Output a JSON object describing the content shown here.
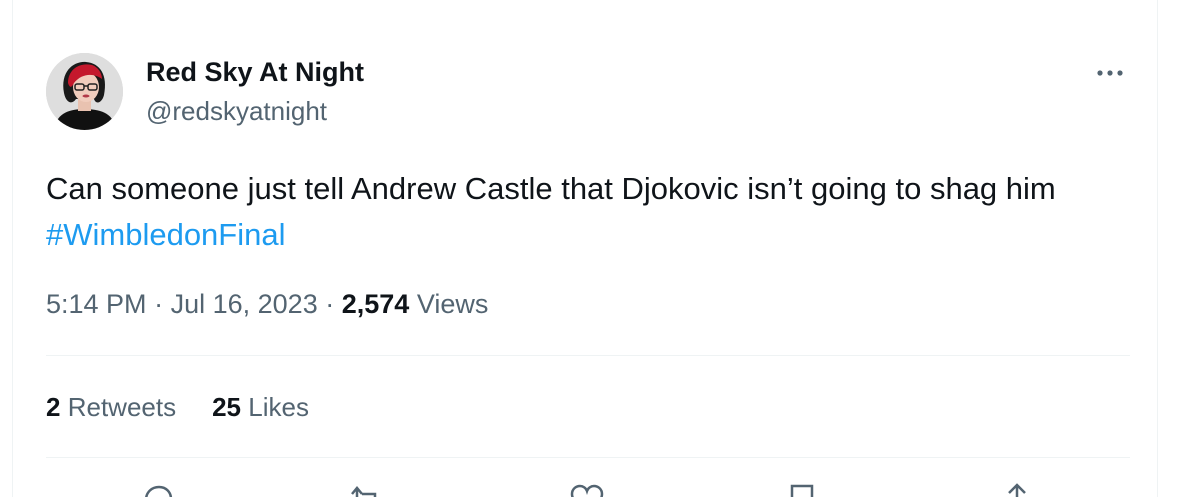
{
  "tweet": {
    "author": {
      "display_name": "Red Sky At Night",
      "handle": "@redskyatnight"
    },
    "text": "Can someone just tell Andrew Castle that Djokovic isn’t going to shag him ",
    "hashtag": "#WimbledonFinal",
    "time": "5:14 PM",
    "separator": "·",
    "date": "Jul 16, 2023",
    "views_count": "2,574",
    "views_label": "Views",
    "retweets_count": "2",
    "retweets_label": "Retweets",
    "likes_count": "25",
    "likes_label": "Likes"
  },
  "icons": {
    "more": "more-dots-icon",
    "actions": [
      "reply-icon",
      "retweet-icon",
      "like-icon",
      "bookmark-icon",
      "share-icon"
    ]
  },
  "colors": {
    "text_primary": "#0f1419",
    "text_secondary": "#536471",
    "link": "#1d9bf0",
    "divider": "#eff3f4"
  }
}
